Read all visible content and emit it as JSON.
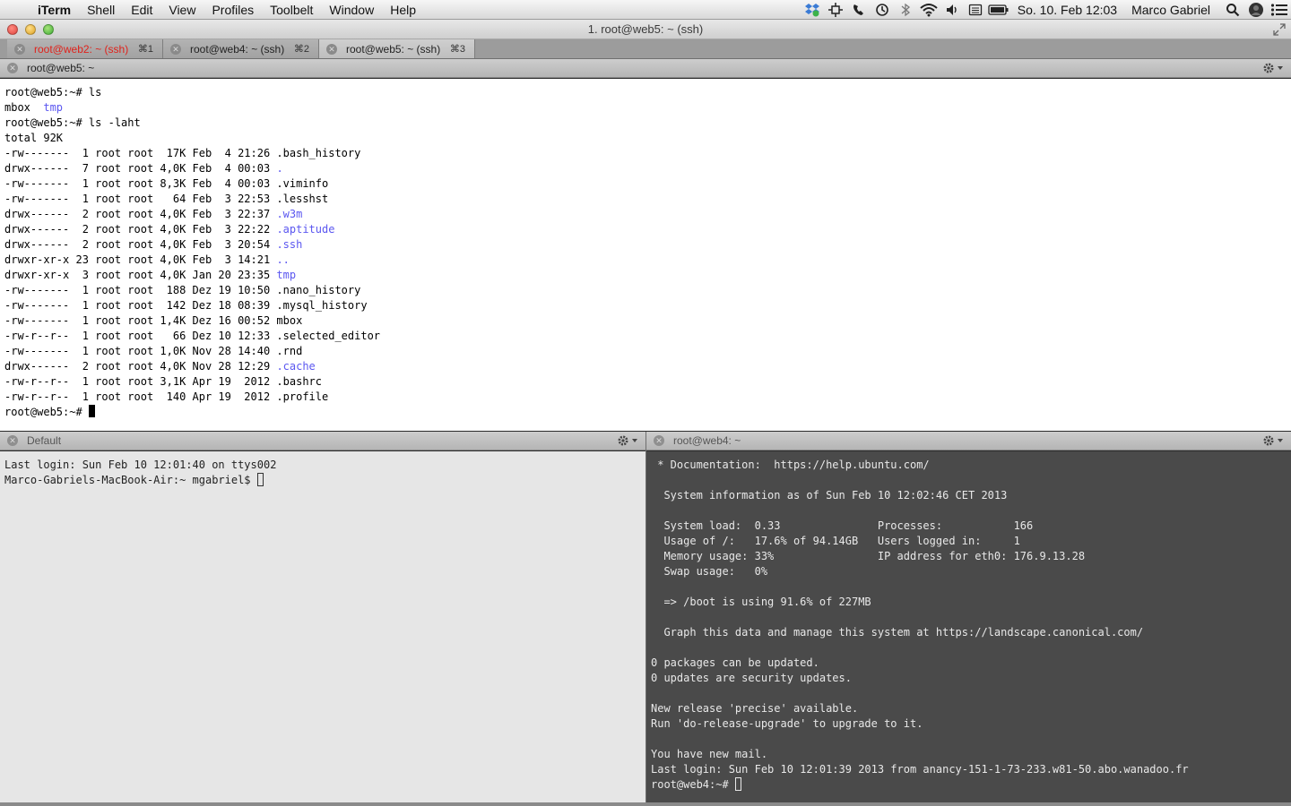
{
  "menubar": {
    "app_name": "iTerm",
    "menus": [
      "Shell",
      "Edit",
      "View",
      "Profiles",
      "Toolbelt",
      "Window",
      "Help"
    ],
    "clock": "So. 10. Feb  12:03",
    "user": "Marco Gabriel"
  },
  "window": {
    "title": "1. root@web5: ~ (ssh)"
  },
  "tabs": [
    {
      "title": "root@web2: ~ (ssh)",
      "shortcut": "⌘1",
      "alert_color": "#e0221b"
    },
    {
      "title": "root@web4: ~ (ssh)",
      "shortcut": "⌘2"
    },
    {
      "title": "root@web5: ~ (ssh)",
      "shortcut": "⌘3"
    }
  ],
  "panes": {
    "top": {
      "title": "root@web5: ~",
      "lines": [
        "root@web5:~# ls",
        "mbox  ",
        "root@web5:~# ls -laht",
        "total 92K",
        "-rw-------  1 root root  17K Feb  4 21:26 .bash_history",
        "drwx------  7 root root 4,0K Feb  4 00:03 ",
        "-rw-------  1 root root 8,3K Feb  4 00:03 .viminfo",
        "-rw-------  1 root root   64 Feb  3 22:53 .lesshst",
        "drwx------  2 root root 4,0K Feb  3 22:37 ",
        "drwx------  2 root root 4,0K Feb  3 22:22 ",
        "drwx------  2 root root 4,0K Feb  3 20:54 ",
        "drwxr-xr-x 23 root root 4,0K Feb  3 14:21 ",
        "drwxr-xr-x  3 root root 4,0K Jan 20 23:35 ",
        "-rw-------  1 root root  188 Dez 19 10:50 .nano_history",
        "-rw-------  1 root root  142 Dez 18 08:39 .mysql_history",
        "-rw-------  1 root root 1,4K Dez 16 00:52 mbox",
        "-rw-r--r--  1 root root   66 Dez 10 12:33 .selected_editor",
        "-rw-------  1 root root 1,0K Nov 28 14:40 .rnd",
        "drwx------  2 root root 4,0K Nov 28 12:29 ",
        "-rw-r--r--  1 root root 3,1K Apr 19  2012 .bashrc",
        "-rw-r--r--  1 root root  140 Apr 19  2012 .profile"
      ],
      "dir_names": {
        "1": "tmp",
        "5": ".",
        "8": ".w3m",
        "9": ".aptitude",
        "10": ".ssh",
        "11": "..",
        "12": "tmp",
        "18": ".cache"
      },
      "prompt": "root@web5:~# ",
      "dir_color": "#5b57f0"
    },
    "bottom_left": {
      "title": "Default",
      "lines": [
        "Last login: Sun Feb 10 12:01:40 on ttys002"
      ],
      "prompt": "Marco-Gabriels-MacBook-Air:~ mgabriel$ "
    },
    "bottom_right": {
      "title": "root@web4: ~",
      "lines": [
        " * Documentation:  https://help.ubuntu.com/",
        "",
        "  System information as of Sun Feb 10 12:02:46 CET 2013",
        "",
        "  System load:  0.33               Processes:           166",
        "  Usage of /:   17.6% of 94.14GB   Users logged in:     1",
        "  Memory usage: 33%                IP address for eth0: 176.9.13.28",
        "  Swap usage:   0%",
        "",
        "  => /boot is using 91.6% of 227MB",
        "",
        "  Graph this data and manage this system at https://landscape.canonical.com/",
        "",
        "0 packages can be updated.",
        "0 updates are security updates.",
        "",
        "New release 'precise' available.",
        "Run 'do-release-upgrade' to upgrade to it.",
        "",
        "You have new mail.",
        "Last login: Sun Feb 10 12:01:39 2013 from anancy-151-1-73-233.w81-50.abo.wanadoo.fr"
      ],
      "prompt": "root@web4:~# "
    }
  },
  "icons": {
    "apple": "apple-icon",
    "status": [
      "dropbox-icon",
      "displays-icon",
      "phone-icon",
      "time-machine-icon",
      "bluetooth-icon",
      "wifi-icon",
      "volume-icon",
      "input-menu-icon",
      "battery-icon",
      "spotlight-icon",
      "user-icon",
      "notification-center-icon"
    ],
    "tab_close": "close-icon",
    "pane_gear": "gear-icon"
  }
}
